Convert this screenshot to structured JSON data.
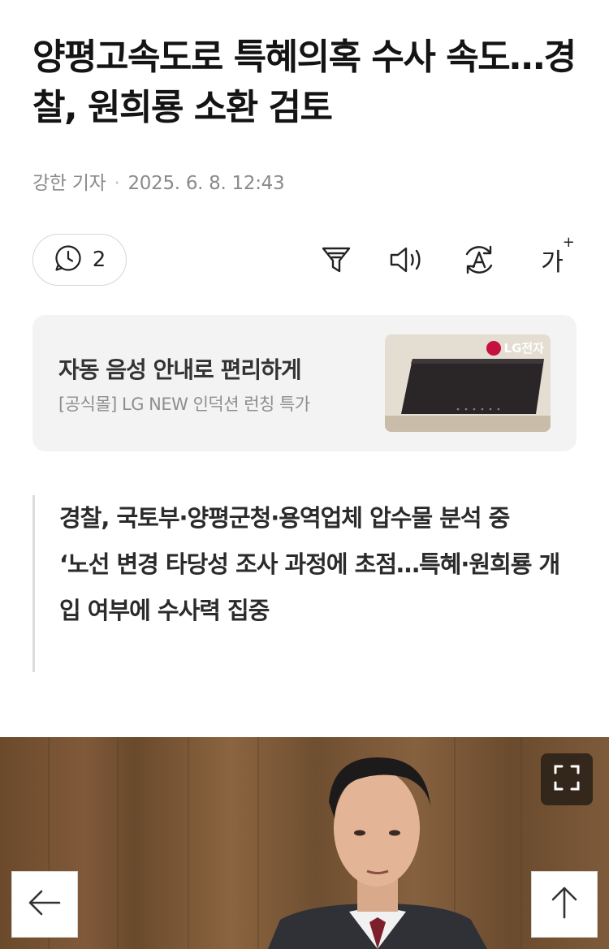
{
  "article": {
    "headline": "양평고속도로 특혜의혹 수사 속도…경찰, 원희룡 소환 검토",
    "reporter": "강한 기자",
    "date": "2025. 6. 8. 12:43"
  },
  "toolbar": {
    "comment_count": "2",
    "font_size_label": "가",
    "font_size_plus": "+",
    "icons": [
      "comment-icon",
      "summary-filter-icon",
      "speaker-icon",
      "translate-icon",
      "font-size-icon"
    ]
  },
  "ad": {
    "title": "자동 음성 안내로 편리하게",
    "subtitle": "[공식몰] LG NEW 인덕션 런칭 특가",
    "brand": "LG전자"
  },
  "summary": {
    "line1": "경찰, 국토부·양평군청·용역업체 압수물 분석 중",
    "line2": "‘노선 변경 타당성 조사 과정에 초점…특혜·원희룡 개입 여부에 수사력 집중"
  },
  "photo": {
    "icons": [
      "fullscreen-icon",
      "arrow-left-icon",
      "arrow-up-icon"
    ]
  },
  "colors": {
    "text": "#141414",
    "meta": "#8a8a8a",
    "ad_bg": "#f3f3f3",
    "lg_red": "#c4113d"
  }
}
